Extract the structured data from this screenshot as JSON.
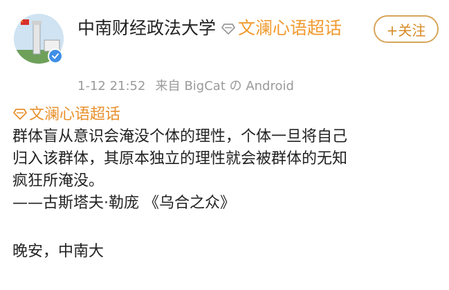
{
  "post": {
    "author": "中南财经政法大学",
    "super_topic": "文澜心语超话",
    "follow_label": "+关注",
    "timestamp": "1-12 21:52",
    "source_prefix": "来自",
    "source": "BigCat の Android",
    "topic_link": "文澜心语超话",
    "body_lines": [
      "群体盲从意识会淹没个体的理性，个体一旦将自己",
      "归入该群体，其原本独立的理性就会被群体的无知",
      "疯狂所淹没。",
      "——古斯塔夫·勒庞 《乌合之众》"
    ],
    "closing": "晚安，中南大"
  },
  "colors": {
    "topic": "#f09a2e",
    "follow": "#d78a25",
    "verified": "#3f8fe6",
    "meta": "#9a9a9a"
  },
  "icons": {
    "avatar": "university-avatar",
    "verified": "verified-badge-icon",
    "topic": "diamond-topic-icon"
  }
}
